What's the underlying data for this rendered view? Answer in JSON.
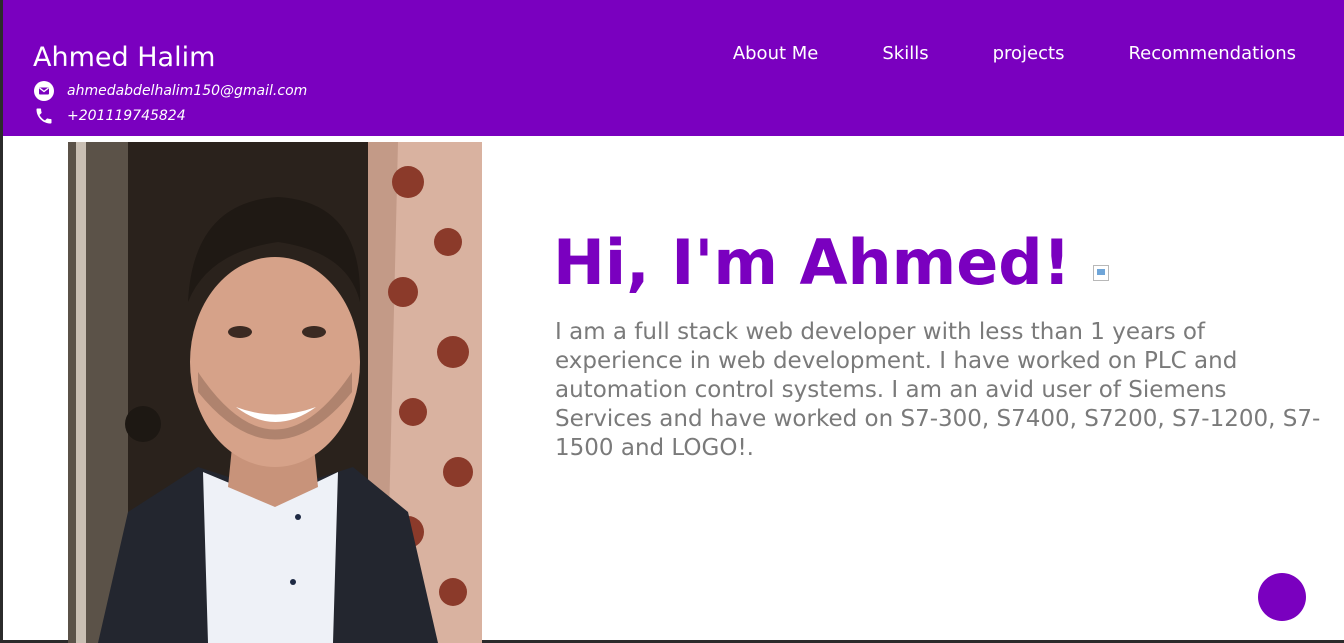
{
  "header": {
    "name": "Ahmed Halim",
    "email": "ahmedabdelhalim150@gmail.com",
    "phone": "+201119745824",
    "nav": [
      {
        "label": "About Me"
      },
      {
        "label": "Skills"
      },
      {
        "label": "projects"
      },
      {
        "label": "Recommendations"
      }
    ]
  },
  "hero": {
    "title": "Hi, I'm Ahmed!",
    "description": "I am a full stack web developer with less than 1 years of experience in web development. I have worked on PLC and automation control systems. I am an avid user of Siemens Services and have worked on S7-300, S7400, S7200, S7-1200, S7-1500 and LOGO!."
  },
  "icons": {
    "email": "email-icon",
    "phone": "phone-icon"
  },
  "colors": {
    "brand": "#7a00bf",
    "text_muted": "#7a7a7a",
    "header_text": "#ffffff"
  }
}
